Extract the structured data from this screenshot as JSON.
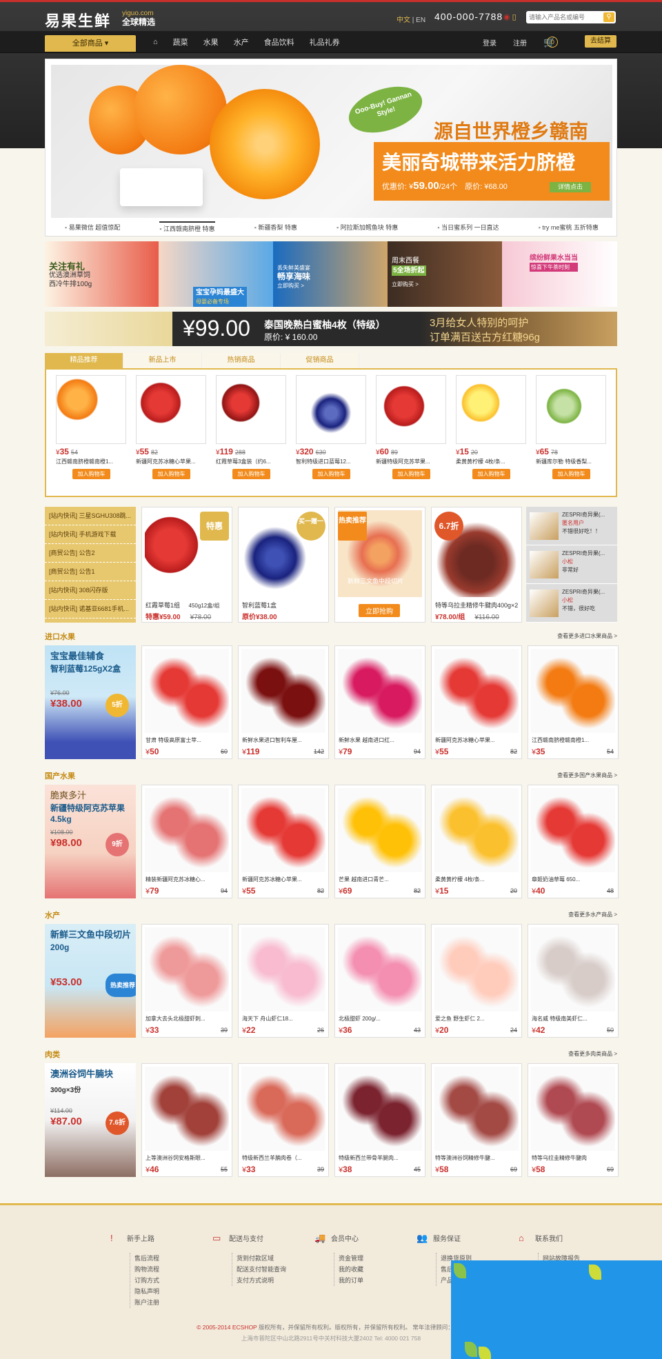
{
  "header": {
    "logo": "易果生鲜",
    "logo_domain": "yiguo.com",
    "logo_slogan": "全球精选",
    "lang_cn": "中文",
    "lang_en": "EN",
    "phone": "400-000-7788",
    "search_placeholder": "请输入产品名或编号"
  },
  "nav": {
    "all_categories": "全部商品 ▾",
    "items": [
      "蔬菜",
      "水果",
      "水产",
      "食品饮料",
      "礼品礼券"
    ],
    "login": "登录",
    "register": "注册",
    "cart_count": "0",
    "checkout": "去结算"
  },
  "banner": {
    "badge": "Ooo-Buy! Gannan Style!",
    "line1": "源自世界橙乡赣南",
    "line2": "美丽奇城带来活力脐橙",
    "price_label": "优惠价: ¥",
    "price": "59.00",
    "price_unit": "/24个",
    "orig_label": "原价: ¥68.00",
    "button": "详情点击",
    "tabs": [
      "易果微信 超值惊配",
      "江西赣南脐橙 特惠",
      "新疆香梨 特惠",
      "阿拉斯加鳕鱼块 特惠",
      "当日蜜系列 一日直达",
      "try me蜜桃 五折特惠"
    ]
  },
  "promos": [
    {
      "t1": "关注有礼",
      "t2": "优选澳洲草饲",
      "t3": "西冷牛排100g"
    },
    {
      "t1": "宝宝孕妈最盛大",
      "t2": "母婴必备专场"
    },
    {
      "t1": "丢失鲜美盛宴",
      "t2": "畅享海味",
      "t3": "立即购买 >"
    },
    {
      "t1": "周末西餐",
      "t2": "5全场折起",
      "t3": "立即购买 >"
    },
    {
      "t1": "缤纷鲜果水当当",
      "t2": "惊喜下午茶时刻"
    }
  ],
  "strip": {
    "price": "¥99.00",
    "title": "泰国晚熟白蜜柚4枚（特级）",
    "orig": "原价: ¥ 160.00",
    "right1": "3月给女人特别的呵护",
    "right2": "订单满百送古方红糖96g"
  },
  "tabs": [
    "精品推荐",
    "新品上市",
    "热销商品",
    "促销商品"
  ],
  "recommend": [
    {
      "price": "35",
      "orig": "54",
      "name": "江西赣南脐橙赣南橙1..."
    },
    {
      "price": "55",
      "orig": "82",
      "name": "新疆阿克苏冰糖心苹果..."
    },
    {
      "price": "119",
      "orig": "288",
      "name": "红霞草莓3盒装（约6..."
    },
    {
      "price": "320",
      "orig": "630",
      "name": "智利特级进口蓝莓12..."
    },
    {
      "price": "60",
      "orig": "89",
      "name": "新疆特级阿克苏苹果..."
    },
    {
      "price": "15",
      "orig": "20",
      "name": "柔黄黄柠檬 4枚/条..."
    },
    {
      "price": "65",
      "orig": "78",
      "name": "新疆库尔勒 特级香梨..."
    }
  ],
  "add_cart": "加入购物车",
  "yen": "¥",
  "news": [
    "[站内快讯] 三星SGHU308跳...",
    "[站内快讯] 手机游戏下载",
    "[商贸公告] 公告2",
    "[商贸公告] 公告1",
    "[站内快讯] 308闪存版",
    "[站内快讯] 诺基亚6681手机..."
  ],
  "features": [
    {
      "badge": "特惠",
      "name": "红霞草莓1组",
      "spec": "450g12盒/组",
      "label": "特惠¥59.00",
      "orig": "¥78.00"
    },
    {
      "badge": "买一赠一",
      "name": "智利蓝莓1盒",
      "spec": "",
      "label": "原价¥38.00",
      "orig": ""
    },
    {
      "badge": "热卖推荐",
      "name": "新鲜三文鱼中段切片",
      "spec": "",
      "label": "立即抢购",
      "orig": ""
    },
    {
      "badge": "6.7折",
      "name": "特等乌拉圭精修牛腱肉400g×2",
      "spec": "",
      "label": "¥78.00/组",
      "orig": "¥116.00"
    }
  ],
  "comments": [
    {
      "t": "ZESPRI奇异果(...",
      "u": "匿名用户",
      "c": "不错很好吃！！"
    },
    {
      "t": "ZESPRI奇异果(...",
      "u": "小松",
      "c": "非常好"
    },
    {
      "t": "ZESPRI奇异果(...",
      "u": "小松",
      "c": "不错，很好吃"
    }
  ],
  "sections": [
    {
      "title": "进口水果",
      "more": "查看更多进口水果商品 >",
      "ban": {
        "l1": "宝宝最佳辅食",
        "l2": "智利蓝莓125gX2盒",
        "orig": "¥76.00",
        "price": "¥38.00",
        "badge": "5折"
      },
      "items": [
        {
          "name": "甘肃 特级高原富士苹...",
          "price": "50",
          "orig": "60"
        },
        {
          "name": "新鲜水果进口智利车厘...",
          "price": "119",
          "orig": "142"
        },
        {
          "name": "新鲜水果 越南进口红...",
          "price": "79",
          "orig": "94"
        },
        {
          "name": "新疆阿克苏冰糖心苹果...",
          "price": "55",
          "orig": "82"
        },
        {
          "name": "江西赣南脐橙赣南橙1...",
          "price": "35",
          "orig": "54"
        }
      ]
    },
    {
      "title": "国产水果",
      "more": "查看更多国产水果商品 >",
      "ban": {
        "l1": "脆爽多汁",
        "l2": "新疆特级阿克苏苹果4.5kg",
        "orig": "¥108.00",
        "price": "¥98.00",
        "badge": "9折"
      },
      "items": [
        {
          "name": "精装新疆阿克苏冰糖心...",
          "price": "79",
          "orig": "94"
        },
        {
          "name": "新疆阿克苏冰糖心苹果...",
          "price": "55",
          "orig": "82"
        },
        {
          "name": "芒果 越南进口青芒...",
          "price": "69",
          "orig": "82"
        },
        {
          "name": "柔黄黄柠檬 4枚/条...",
          "price": "15",
          "orig": "20"
        },
        {
          "name": "章姬奶油草莓 650...",
          "price": "40",
          "orig": "48"
        }
      ]
    },
    {
      "title": "水产",
      "more": "查看更多水产商品 >",
      "ban": {
        "l1": "新鲜三文鱼中段切片",
        "l2": "200g",
        "orig": "",
        "price": "¥53.00",
        "badge": "热卖推荐"
      },
      "items": [
        {
          "name": "加拿大去头北极甜虾刺...",
          "price": "33",
          "orig": "39"
        },
        {
          "name": "海天下 舟山虾仁18...",
          "price": "22",
          "orig": "26"
        },
        {
          "name": "北极甜虾 200g/...",
          "price": "36",
          "orig": "43"
        },
        {
          "name": "爱之鱼 野生虾仁 2...",
          "price": "20",
          "orig": "24"
        },
        {
          "name": "海名威 特级南美虾仁...",
          "price": "42",
          "orig": "50"
        }
      ]
    },
    {
      "title": "肉类",
      "more": "查看更多肉类商品 >",
      "ban": {
        "l1": "澳洲谷饲牛腩块",
        "l2": "300g×3份",
        "orig": "¥114.00",
        "price": "¥87.00",
        "badge": "7.6折"
      },
      "items": [
        {
          "name": "上等澳洲谷饲安格斯眼...",
          "price": "46",
          "orig": "55"
        },
        {
          "name": "特级新西兰羊腩肉卷（...",
          "price": "33",
          "orig": "39"
        },
        {
          "name": "特级新西兰带骨羊腿肉...",
          "price": "38",
          "orig": "45"
        },
        {
          "name": "特等澳洲谷饲精修牛腱...",
          "price": "58",
          "orig": "69"
        },
        {
          "name": "特等乌拉圭精修牛腱肉",
          "price": "58",
          "orig": "69"
        }
      ]
    }
  ],
  "footer": {
    "cols": [
      {
        "title": "新手上路",
        "icon": "!",
        "links": [
          "售后流程",
          "购物流程",
          "订购方式",
          "隐私声明",
          "账户注册"
        ]
      },
      {
        "title": "配送与支付",
        "icon": "▭",
        "links": [
          "货到付款区域",
          "配送支付智能查询",
          "支付方式说明"
        ]
      },
      {
        "title": "会员中心",
        "icon": "🚚",
        "links": [
          "资金管理",
          "我的收藏",
          "我的订单"
        ]
      },
      {
        "title": "服务保证",
        "icon": "👥",
        "links": [
          "退换货原则",
          "售后服务保证",
          "产品质量保证"
        ]
      },
      {
        "title": "联系我们",
        "icon": "⌂",
        "links": [
          "网站故障报告"
        ]
      }
    ],
    "copyright_brand": "© 2005-2014 ECSHOP",
    "copyright_rest": " 版权所有，并保留所有权利。版权所有，并保留所有权利。 常年法律顾问：上海",
    "address": "上海市普陀区中山北路2911号中关村科技大厦2402 Tel: 4000 021 758"
  },
  "colors": {
    "gold": "#e0b84d",
    "orange": "#f28b1c",
    "red": "#c9302c",
    "dark": "#232323"
  }
}
